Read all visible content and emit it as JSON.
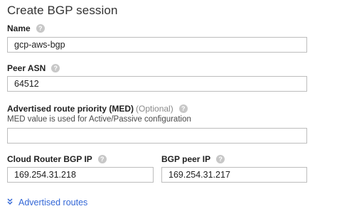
{
  "title": "Create BGP session",
  "fields": {
    "name": {
      "label": "Name",
      "value": "gcp-aws-bgp"
    },
    "peer_asn": {
      "label": "Peer ASN",
      "value": "64512"
    },
    "med": {
      "label": "Advertised route priority (MED)",
      "optional": "(Optional)",
      "description": "MED value is used for Active/Passive configuration",
      "value": ""
    },
    "cloud_router_ip": {
      "label": "Cloud Router BGP IP",
      "value": "169.254.31.218"
    },
    "bgp_peer_ip": {
      "label": "BGP peer IP",
      "value": "169.254.31.217"
    }
  },
  "advertised_routes": {
    "label": "Advertised routes",
    "icon": "chevron-double-down-icon"
  },
  "colors": {
    "link": "#3367d6",
    "border": "#bdbdbd",
    "help_icon": "#c7c7c7"
  }
}
